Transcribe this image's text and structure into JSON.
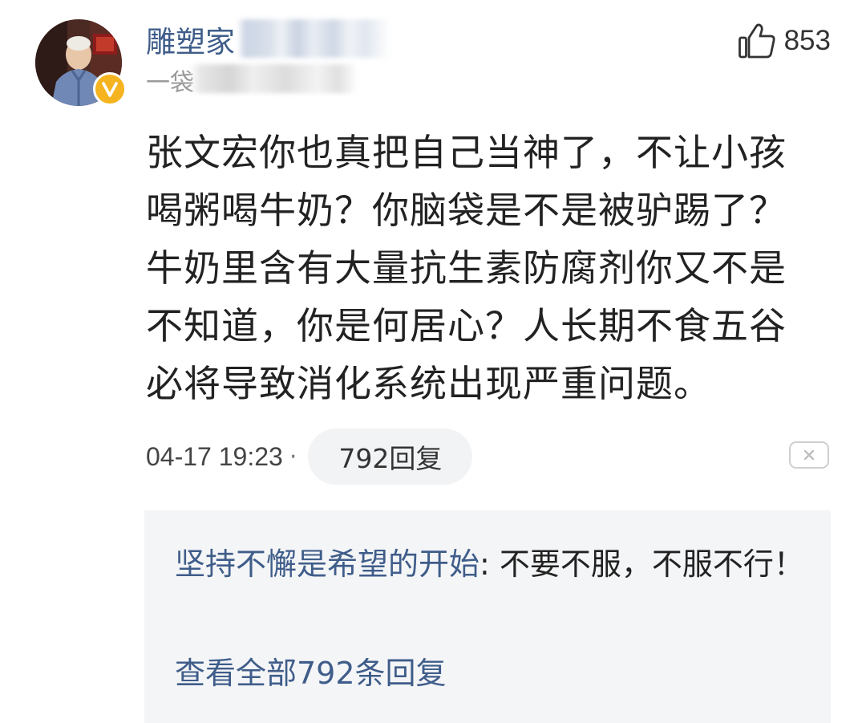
{
  "comment": {
    "author": {
      "name": "雕塑家",
      "subtitle": "一袋",
      "verified_icon": "verified-v-badge-icon",
      "badge_color": "#f5b41f"
    },
    "likes": {
      "icon": "thumbs-up-icon",
      "count": "853"
    },
    "text": "张文宏你也真把自己当神了，不让小孩喝粥喝牛奶？你脑袋是不是被驴踢了？牛奶里含有大量抗生素防腐剂你又不是不知道，你是何居心？人长期不食五谷必将导致消化系统出现严重问题。",
    "timestamp": "04-17 19:23",
    "separator": "·",
    "reply_button": "792回复",
    "close_icon": "close-x-icon"
  },
  "replies": {
    "items": [
      {
        "author": "坚持不懈是希望的开始",
        "separator": ": ",
        "text": "不要不服，不服不行！"
      }
    ],
    "view_all": "查看全部792条回复"
  },
  "colors": {
    "link": "#3f5d8a",
    "text": "#222222",
    "muted": "#9a9a9a",
    "reply_bg": "#f4f5f7"
  }
}
